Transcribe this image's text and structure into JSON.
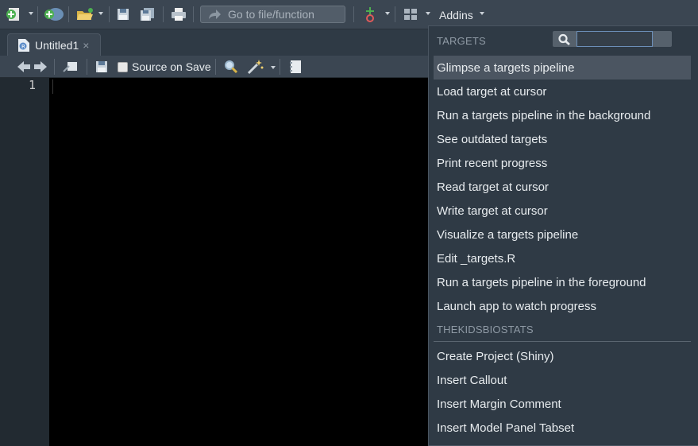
{
  "toolbar": {
    "goto_placeholder": "Go to file/function",
    "addins_label": "Addins"
  },
  "tab": {
    "title": "Untitled1",
    "close_glyph": "×"
  },
  "editor_toolbar": {
    "source_on_save": "Source on Save"
  },
  "editor": {
    "line_numbers": [
      "1"
    ]
  },
  "addins_menu": {
    "search_value": "",
    "sections": [
      {
        "header": "TARGETS",
        "items": [
          "Glimpse a targets pipeline",
          "Load target at cursor",
          "Run a targets pipeline in the background",
          "See outdated targets",
          "Print recent progress",
          "Read target at cursor",
          "Write target at cursor",
          "Visualize a targets pipeline",
          "Edit _targets.R",
          "Run a targets pipeline in the foreground",
          "Launch app to watch progress"
        ]
      },
      {
        "header": "THEKIDSBIOSTATS",
        "items": [
          "Create Project (Shiny)",
          "Insert Callout",
          "Insert Margin Comment",
          "Insert Model Panel Tabset"
        ]
      }
    ]
  },
  "colors": {
    "toolbar_bg": "#3b4652",
    "menu_bg": "#2f3a45",
    "menu_highlight": "#4b5561",
    "editor_bg": "#000000"
  }
}
